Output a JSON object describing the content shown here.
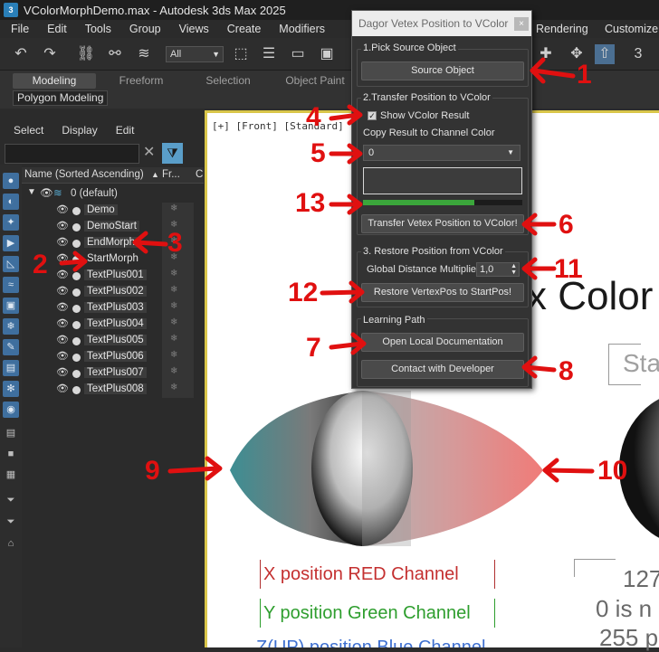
{
  "window": {
    "title": "VColorMorphDemo.max - Autodesk 3ds Max 2025",
    "app_icon": "3"
  },
  "menu": [
    "File",
    "Edit",
    "Tools",
    "Group",
    "Views",
    "Create",
    "Modifiers",
    "Rendering",
    "Customize"
  ],
  "toolbar": {
    "selection_filter": "All"
  },
  "ribbon": {
    "tabs": [
      "Modeling",
      "Freeform",
      "Selection",
      "Object Paint"
    ],
    "active_tab": "Modeling",
    "sub_panel": "Polygon Modeling"
  },
  "scene_explorer": {
    "menu": [
      "Select",
      "Display",
      "Edit"
    ],
    "columns": {
      "name": "Name (Sorted Ascending)",
      "frozen": "Fr...",
      "extra": "C"
    },
    "layer": "0 (default)",
    "objects": [
      "Demo",
      "DemoStart",
      "EndMorph",
      "StartMorph",
      "TextPlus001",
      "TextPlus002",
      "TextPlus003",
      "TextPlus004",
      "TextPlus005",
      "TextPlus006",
      "TextPlus007",
      "TextPlus008"
    ]
  },
  "viewport": {
    "label": "[+] [Front] [Standard] [Default...",
    "title_text": "x Color",
    "start_text": "Sta",
    "red_text": "X position RED Channel",
    "green_text": "Y position Green Channel",
    "blue_text": "Z(UP) position Blue Channel",
    "num_line1": "127",
    "num_line2": "0 is n",
    "num_line3": "255 p"
  },
  "dialog": {
    "title": "Dagor Vetex Position to VColor",
    "close_label": "×",
    "group1": {
      "label": "1.Pick Source Object",
      "button": "Source Object"
    },
    "group2": {
      "label": "2.Transfer Position to VColor",
      "checkbox_label": "Show VColor Result",
      "checkbox_checked": true,
      "copy_label": "Copy Result to Channel Color",
      "channel_value": "0",
      "progress": 0.7,
      "button": "Transfer Vetex Position to VColor!"
    },
    "group3": {
      "label": "3. Restore Position from VColor",
      "multiplier_label": "Global Distance Multiplier",
      "multiplier_value": "1,0",
      "button": "Restore VertexPos to StartPos!"
    },
    "learning": {
      "label": "Learning Path",
      "doc_button": "Open Local Documentation",
      "contact_button": "Contact with Developer"
    }
  },
  "annotations": [
    "1",
    "2",
    "3",
    "4",
    "5",
    "6",
    "7",
    "8",
    "9",
    "10",
    "11",
    "12",
    "13"
  ],
  "colors": {
    "annotation": "#e01010",
    "accent_blue": "#5a9ec9",
    "progress_green": "#3ba63b",
    "viewport_border": "#d9c64a"
  }
}
